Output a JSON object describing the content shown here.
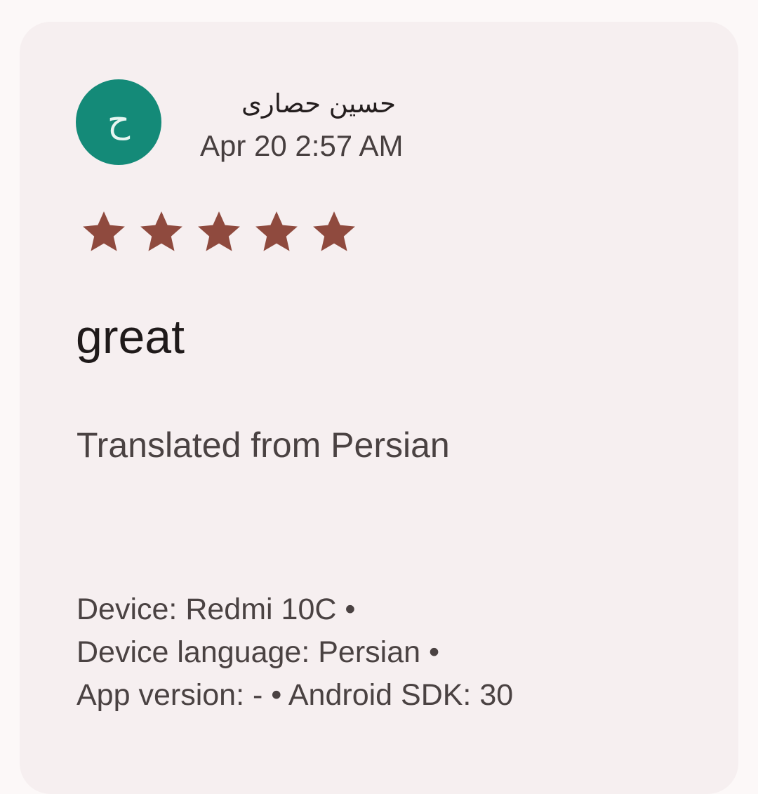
{
  "review": {
    "avatar_letter": "ح",
    "author_name": "حسین حصاری",
    "date": "Apr 20 2:57 AM",
    "rating": 5,
    "rating_max": 5,
    "text": "great",
    "translation_note": "Translated from Persian",
    "device_line": "Device: Redmi 10C •",
    "language_line": "Device language: Persian •",
    "version_line": "App version: - • Android SDK: 30"
  },
  "colors": {
    "avatar_bg": "#148a78",
    "star": "#8f4a3e",
    "card_bg": "#f6eff0"
  },
  "icons": {
    "star": "star-icon"
  }
}
